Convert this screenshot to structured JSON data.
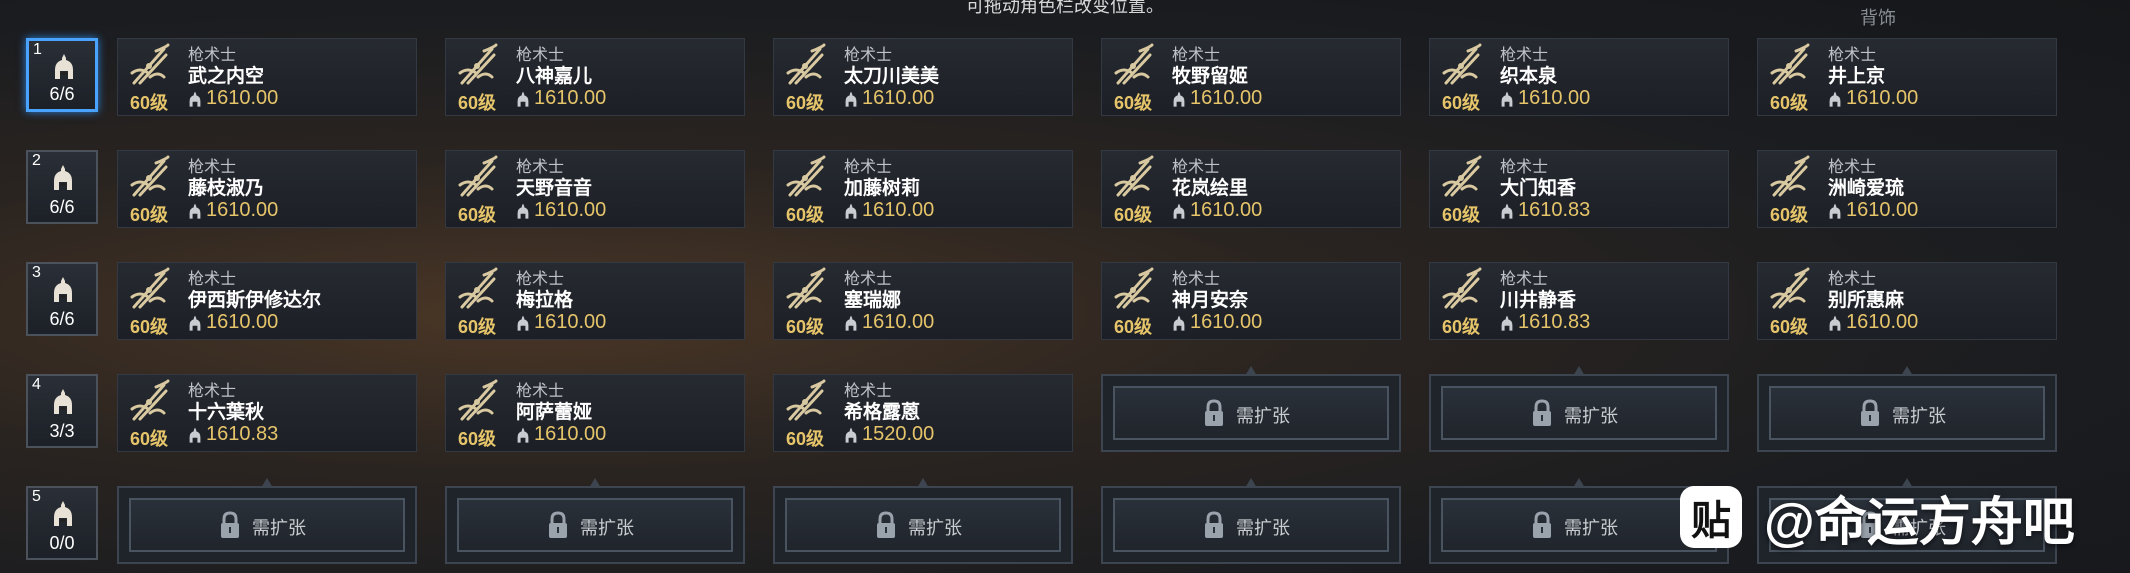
{
  "header": {
    "hint": "可拖动角色栏改变位置。",
    "top_right": "背饰"
  },
  "rows": [
    {
      "index": "1",
      "count": "6/6",
      "selected": true,
      "slots": [
        {
          "class": "枪术士",
          "name": "武之内空",
          "level": "60级",
          "ilvl": "1610.00"
        },
        {
          "class": "枪术士",
          "name": "八神嘉儿",
          "level": "60级",
          "ilvl": "1610.00"
        },
        {
          "class": "枪术士",
          "name": "太刀川美美",
          "level": "60级",
          "ilvl": "1610.00"
        },
        {
          "class": "枪术士",
          "name": "牧野留姬",
          "level": "60级",
          "ilvl": "1610.00"
        },
        {
          "class": "枪术士",
          "name": "织本泉",
          "level": "60级",
          "ilvl": "1610.00"
        },
        {
          "class": "枪术士",
          "name": "井上京",
          "level": "60级",
          "ilvl": "1610.00"
        }
      ]
    },
    {
      "index": "2",
      "count": "6/6",
      "selected": false,
      "slots": [
        {
          "class": "枪术士",
          "name": "藤枝淑乃",
          "level": "60级",
          "ilvl": "1610.00"
        },
        {
          "class": "枪术士",
          "name": "天野音音",
          "level": "60级",
          "ilvl": "1610.00"
        },
        {
          "class": "枪术士",
          "name": "加藤树莉",
          "level": "60级",
          "ilvl": "1610.00"
        },
        {
          "class": "枪术士",
          "name": "花岚绘里",
          "level": "60级",
          "ilvl": "1610.00"
        },
        {
          "class": "枪术士",
          "name": "大门知香",
          "level": "60级",
          "ilvl": "1610.83"
        },
        {
          "class": "枪术士",
          "name": "洲崎爱琉",
          "level": "60级",
          "ilvl": "1610.00"
        }
      ]
    },
    {
      "index": "3",
      "count": "6/6",
      "selected": false,
      "slots": [
        {
          "class": "枪术士",
          "name": "伊西斯伊修达尔",
          "level": "60级",
          "ilvl": "1610.00"
        },
        {
          "class": "枪术士",
          "name": "梅拉格",
          "level": "60级",
          "ilvl": "1610.00"
        },
        {
          "class": "枪术士",
          "name": "塞瑞娜",
          "level": "60级",
          "ilvl": "1610.00"
        },
        {
          "class": "枪术士",
          "name": "神月安奈",
          "level": "60级",
          "ilvl": "1610.00"
        },
        {
          "class": "枪术士",
          "name": "川井静香",
          "level": "60级",
          "ilvl": "1610.83"
        },
        {
          "class": "枪术士",
          "name": "别所惠麻",
          "level": "60级",
          "ilvl": "1610.00"
        }
      ]
    },
    {
      "index": "4",
      "count": "3/3",
      "selected": false,
      "slots": [
        {
          "class": "枪术士",
          "name": "十六葉秋",
          "level": "60级",
          "ilvl": "1610.83"
        },
        {
          "class": "枪术士",
          "name": "阿萨蕾娅",
          "level": "60级",
          "ilvl": "1610.00"
        },
        {
          "class": "枪术士",
          "name": "希格露蒽",
          "level": "60级",
          "ilvl": "1520.00"
        },
        {
          "locked": true,
          "label": "需扩张"
        },
        {
          "locked": true,
          "label": "需扩张"
        },
        {
          "locked": true,
          "label": "需扩张"
        }
      ]
    },
    {
      "index": "5",
      "count": "0/0",
      "selected": false,
      "slots": [
        {
          "locked": true,
          "label": "需扩张"
        },
        {
          "locked": true,
          "label": "需扩张"
        },
        {
          "locked": true,
          "label": "需扩张"
        },
        {
          "locked": true,
          "label": "需扩张"
        },
        {
          "locked": true,
          "label": "需扩张"
        },
        {
          "locked": true,
          "label": "需扩张"
        }
      ]
    }
  ],
  "watermark": {
    "badge": "贴",
    "text": "@命运方舟吧"
  },
  "colors": {
    "accent": "#4aa3ff",
    "gold": "#e6c46a"
  },
  "icons": {
    "class_icon": "lancer-emblem-icon",
    "row_icon": "helmet-icon",
    "gear_icon": "helmet-small-icon",
    "lock_icon": "lock-icon"
  }
}
